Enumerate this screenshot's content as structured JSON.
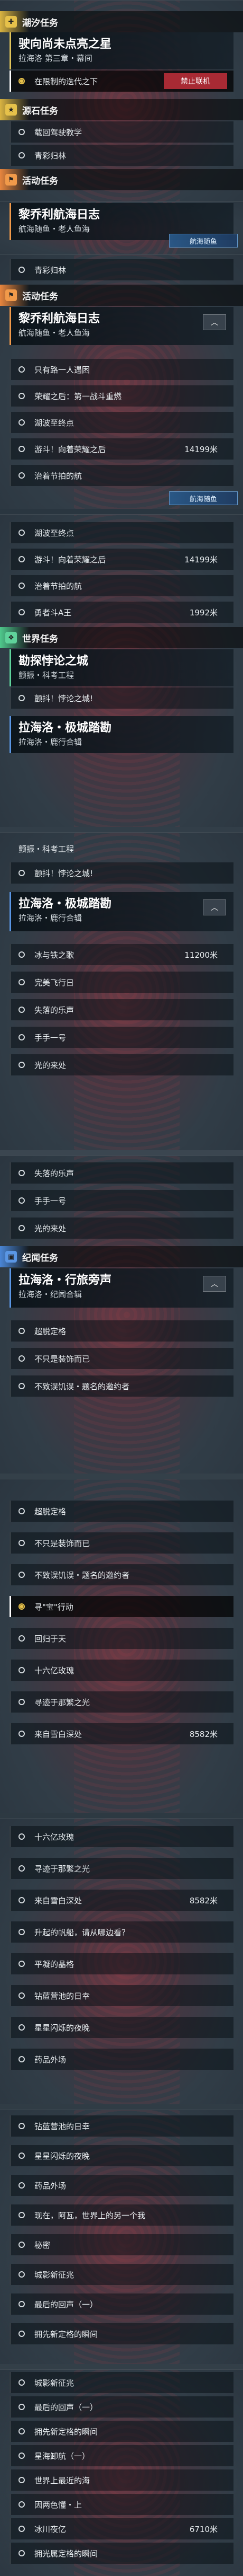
{
  "colors": {
    "daily": "#e6c14a",
    "event": "#f19a4a",
    "world": "#5fd39b",
    "story": "#5a96e4"
  },
  "panels": [
    {
      "section": "潮汐任务",
      "section_icon": "plus-icon",
      "card": {
        "title": "驶向尚未点亮之星",
        "subtitle": "拉海洛 第三章・幕间"
      },
      "rows": [
        {
          "text": "在限制的迭代之下",
          "active": true,
          "badge": "禁止联机"
        }
      ],
      "section2": "源石任务",
      "rows2": [
        {
          "text": "载回驾驶教学"
        },
        {
          "text": "青彩归林"
        }
      ],
      "section3": "活动任务",
      "card3": {
        "title": "黎乔利航海日志",
        "subtitle": "航海随鱼・老人鱼海"
      },
      "tag3": "航海随鱼",
      "rows3": [
        {
          "text": "青彩归林"
        }
      ]
    }
  ],
  "p1": {
    "tide_label": "潮汐任务",
    "tide_title": "驶向尚未点亮之星",
    "tide_sub": "拉海洛 第三章・幕间",
    "tide_row": "在限制的迭代之下",
    "tide_badge": "禁止联机",
    "side_label": "源石任务",
    "side_row1": "载回驾驶教学",
    "side_row2": "青彩归林",
    "event_label": "活动任务",
    "event_title": "黎乔利航海日志",
    "event_sub": "航海随鱼・老人鱼海",
    "event_tag": "航海随鱼"
  },
  "p2": {
    "row_top": "青彩归林",
    "event_label": "活动任务",
    "event_title": "黎乔利航海日志",
    "event_sub": "航海随鱼・老人鱼海",
    "collapse": "︿",
    "rows": [
      {
        "text": "只有路一人遇困",
        "dist": ""
      },
      {
        "text": "荣耀之后：第一战斗重燃",
        "dist": ""
      },
      {
        "text": "湖波至终点",
        "dist": ""
      },
      {
        "text": "游斗！向着荣耀之后",
        "dist": "14199米"
      },
      {
        "text": "治着节拍的航",
        "dist": ""
      }
    ],
    "tag": "航海随鱼"
  },
  "p3": {
    "rows": [
      {
        "text": "湖波至终点",
        "dist": ""
      },
      {
        "text": "游斗！向着荣耀之后",
        "dist": "14199米"
      },
      {
        "text": "治着节拍的航",
        "dist": ""
      },
      {
        "text": "勇者斗A王",
        "dist": "1992米"
      }
    ],
    "world_label": "世界任务",
    "world_title": "勘探悖论之城",
    "world_sub": "颤振・科考工程",
    "world_row": "颤抖！悖论之城!",
    "story_title": "拉海洛・极城踏勘",
    "story_sub": "拉海洛・鹿行合辑"
  },
  "p4": {
    "top_sub": "颤振・科考工程",
    "top_row": "颤抖！悖论之城!",
    "title": "拉海洛・极城踏勘",
    "sub": "拉海洛・鹿行合辑",
    "collapse": "︿",
    "rows": [
      {
        "text": "冰与铁之歌",
        "dist": "11200米"
      },
      {
        "text": "完美飞行日",
        "dist": ""
      },
      {
        "text": "失落的乐声",
        "dist": ""
      },
      {
        "text": "手手一号",
        "dist": ""
      },
      {
        "text": "光的来处",
        "dist": ""
      }
    ]
  },
  "p5": {
    "rows": [
      {
        "text": "失落的乐声"
      },
      {
        "text": "手手一号"
      },
      {
        "text": "光的来处"
      }
    ],
    "label": "纪闻任务",
    "title": "拉海洛・行旅旁声",
    "sub": "拉海洛・纪闻合辑",
    "collapse": "︿",
    "rows2": [
      {
        "text": "超脱定格"
      },
      {
        "text": "不只是装饰而已"
      },
      {
        "text": "不致误饥误・题名的邀约者"
      }
    ]
  },
  "p6": {
    "rows": [
      {
        "text": "超脱定格",
        "dist": ""
      },
      {
        "text": "不只是装饰而已",
        "dist": ""
      },
      {
        "text": "不致误饥误・题名的邀约者",
        "dist": ""
      },
      {
        "text": "寻\"宝\"行动",
        "dist": "",
        "active": true
      },
      {
        "text": "回归于天",
        "dist": ""
      },
      {
        "text": "十六亿玫瑰",
        "dist": ""
      },
      {
        "text": "寻迹于那繁之光",
        "dist": ""
      },
      {
        "text": "来自雪白深处",
        "dist": "8582米"
      }
    ]
  },
  "p7": {
    "rows": [
      {
        "text": "十六亿玫瑰",
        "dist": ""
      },
      {
        "text": "寻迹于那繁之光",
        "dist": ""
      },
      {
        "text": "来自雪白深处",
        "dist": "8582米"
      },
      {
        "text": "升起的帆船，请从哪边看？",
        "dist": ""
      },
      {
        "text": "平凝的晶格",
        "dist": ""
      },
      {
        "text": "钻蓝营池的日幸",
        "dist": ""
      },
      {
        "text": "星星闪烁的夜晚",
        "dist": ""
      },
      {
        "text": "药品外场",
        "dist": ""
      }
    ]
  },
  "p8": {
    "rows": [
      {
        "text": "钻蓝营池的日幸"
      },
      {
        "text": "星星闪烁的夜晚"
      },
      {
        "text": "药品外场"
      },
      {
        "text": "现在，阿瓦，世界上的另一个我"
      },
      {
        "text": "秘密"
      },
      {
        "text": "城影新征兆"
      },
      {
        "text": "最后的回声（一）"
      },
      {
        "text": "拥先新定格的瞬间"
      }
    ]
  },
  "p9": {
    "rows": [
      {
        "text": "城影新征兆",
        "dist": ""
      },
      {
        "text": "最后的回声（一）",
        "dist": ""
      },
      {
        "text": "拥先新定格的瞬间",
        "dist": ""
      },
      {
        "text": "星海卸航（一）",
        "dist": ""
      },
      {
        "text": "世界上最近的海",
        "dist": ""
      },
      {
        "text": "因两色懂・上",
        "dist": ""
      },
      {
        "text": "冰川夜亿",
        "dist": "6710米"
      },
      {
        "text": "拥光属定格的瞬间",
        "dist": ""
      }
    ]
  }
}
